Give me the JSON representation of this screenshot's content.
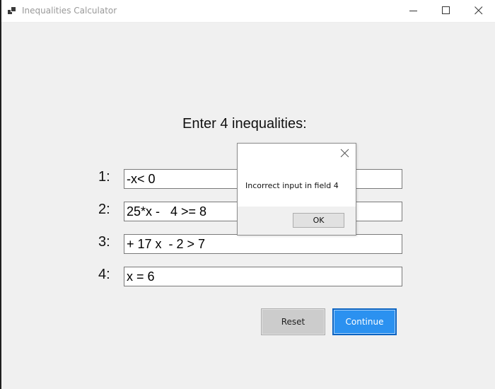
{
  "window": {
    "title": "Inequalities Calculator",
    "icon": "app-icon",
    "controls": [
      "minimize-icon",
      "maximize-icon",
      "close-icon"
    ]
  },
  "main": {
    "heading": "Enter 4 inequalities:",
    "rows": [
      {
        "label": "1:",
        "value": "-x< 0"
      },
      {
        "label": "2:",
        "value": "25*x -   4 >= 8"
      },
      {
        "label": "3:",
        "value": "+ 17 x  - 2 > 7"
      },
      {
        "label": "4:",
        "value": "x = 6"
      }
    ],
    "buttons": {
      "reset": "Reset",
      "continue": "Continue"
    }
  },
  "dialog": {
    "message": "Incorrect input in field 4",
    "ok": "OK"
  },
  "colors": {
    "background": "#f0f0f0",
    "accent": "#2b91f0",
    "accent_border": "#0a63c2"
  }
}
